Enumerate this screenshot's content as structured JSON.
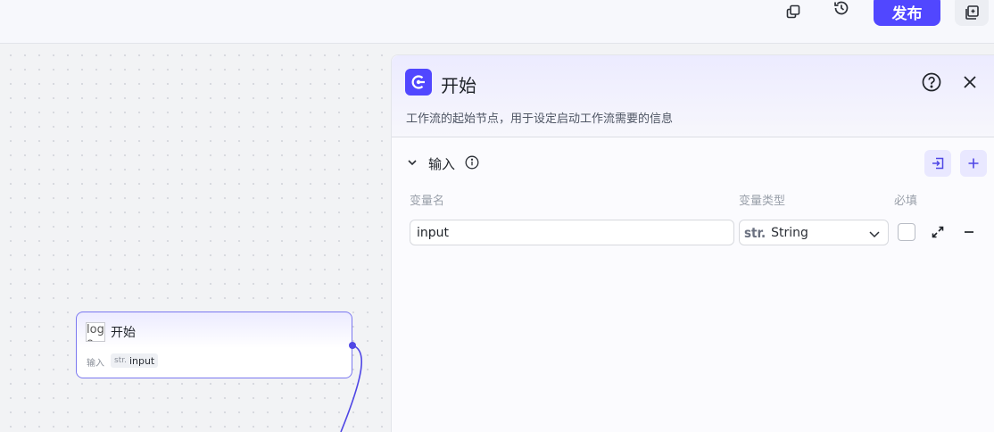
{
  "toolbar": {
    "publish_label": "发布",
    "icons": [
      "copy-icon",
      "history-icon",
      "duplicate-icon"
    ]
  },
  "canvas": {
    "node": {
      "logo_alt": "logo",
      "title": "开始",
      "input_label": "输入",
      "tag_type": "str.",
      "tag_name": "input"
    }
  },
  "panel": {
    "title": "开始",
    "description": "工作流的起始节点，用于设定启动工作流需要的信息",
    "section_title": "输入",
    "columns": {
      "name": "变量名",
      "type": "变量类型",
      "required": "必填"
    },
    "rows": [
      {
        "name": "input",
        "type_prefix": "str.",
        "type": "String",
        "required": false
      }
    ]
  },
  "colors": {
    "accent": "#5147ff",
    "edge": "#4f46e5"
  }
}
